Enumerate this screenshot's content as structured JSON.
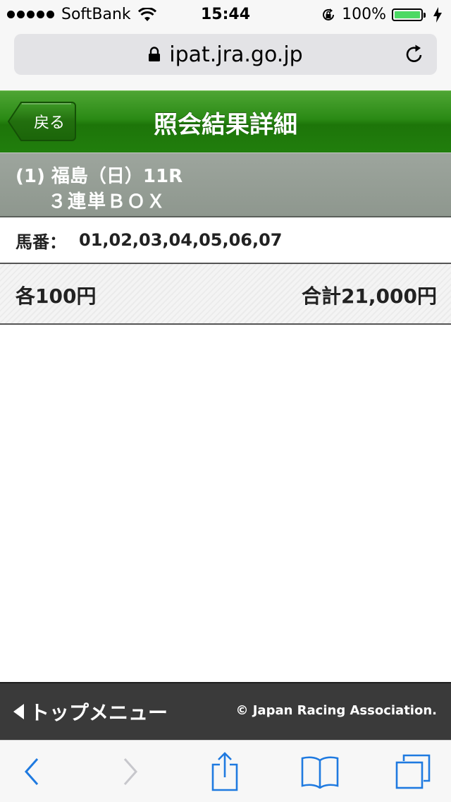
{
  "status_bar": {
    "carrier": "SoftBank",
    "time": "15:44",
    "battery": "100%",
    "battery_level": 1.0
  },
  "browser": {
    "url": "ipat.jra.go.jp"
  },
  "header": {
    "back_label": "戻る",
    "title": "照会結果詳細"
  },
  "race": {
    "line1": "(1) 福島（日）11R",
    "line2": "３連単ＢＯＸ"
  },
  "horses": {
    "label": "馬番：",
    "values": "01,02,03,04,05,06,07"
  },
  "amount": {
    "each": "各100円",
    "total": "合計21,000円"
  },
  "footer": {
    "top_menu_label": "トップメニュー",
    "copyright": "© Japan Racing Association."
  },
  "colors": {
    "header_green": "#2b8a15",
    "race_band_gray": "#959d95",
    "footer_dark": "#3a3a3a",
    "ios_blue": "#1f7ae0",
    "battery_green": "#4cd964"
  }
}
